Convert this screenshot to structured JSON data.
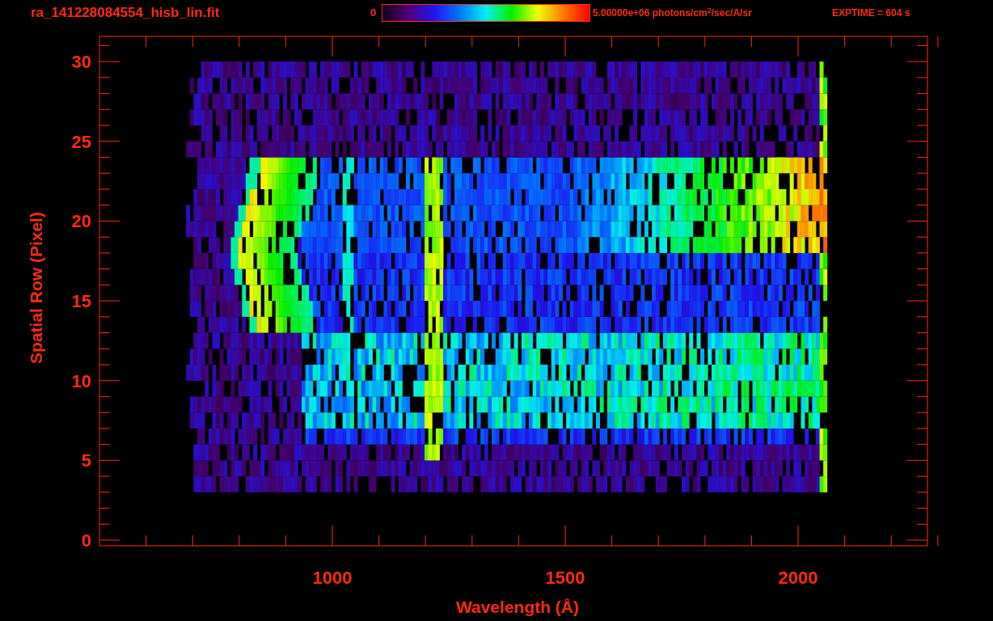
{
  "title": "ra_141228084554_hisb_lin.fit",
  "colorbar": {
    "min_label": "0",
    "max_label": "5.00000e+06 photons/cm$^{2}$/sec/A/sr",
    "exptime": "EXPTIME = 604 s"
  },
  "plot": {
    "ylabel": "Spatial Row (Pixel)",
    "xlabel": "Wavelength (Å)",
    "yticks": [
      {
        "label": "30"
      },
      {
        "label": "25"
      },
      {
        "label": "20"
      },
      {
        "label": "15"
      },
      {
        "label": "10"
      },
      {
        "label": "5"
      },
      {
        "label": "0"
      }
    ],
    "xticks": [
      {
        "label": "1000"
      },
      {
        "label": "1500"
      },
      {
        "label": "2000"
      }
    ]
  }
}
